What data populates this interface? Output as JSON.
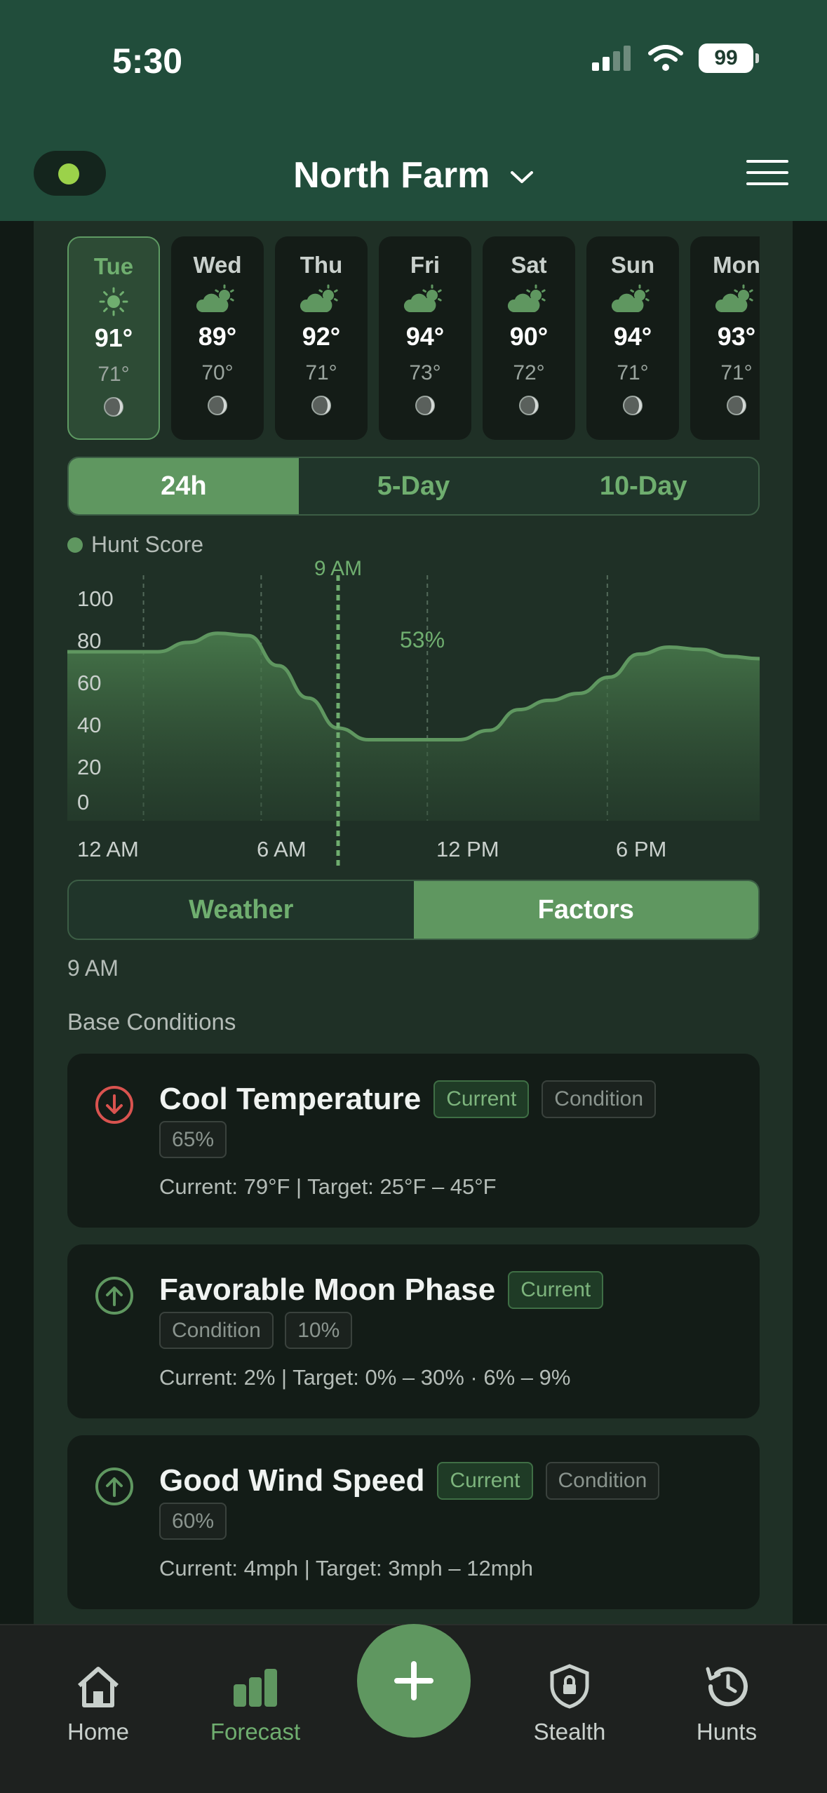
{
  "status": {
    "time": "5:30",
    "battery": "99"
  },
  "header": {
    "location": "North Farm"
  },
  "days": [
    {
      "name": "Tue",
      "hi": "91°",
      "lo": "71°",
      "icon": "sun-icon",
      "selected": true
    },
    {
      "name": "Wed",
      "hi": "89°",
      "lo": "70°",
      "icon": "partly-cloudy-icon"
    },
    {
      "name": "Thu",
      "hi": "92°",
      "lo": "71°",
      "icon": "partly-cloudy-icon"
    },
    {
      "name": "Fri",
      "hi": "94°",
      "lo": "73°",
      "icon": "partly-cloudy-icon"
    },
    {
      "name": "Sat",
      "hi": "90°",
      "lo": "72°",
      "icon": "partly-cloudy-icon"
    },
    {
      "name": "Sun",
      "hi": "94°",
      "lo": "71°",
      "icon": "partly-cloudy-icon"
    },
    {
      "name": "Mon",
      "hi": "93°",
      "lo": "71°",
      "icon": "partly-cloudy-icon"
    }
  ],
  "range_tabs": [
    "24h",
    "5-Day",
    "10-Day"
  ],
  "legend": "Hunt Score",
  "chart_data": {
    "type": "area",
    "series": [
      {
        "name": "Hunt Score",
        "x": [
          0,
          1,
          2,
          3,
          4,
          5,
          6,
          7,
          8,
          9,
          10,
          11,
          12,
          13,
          14,
          15,
          16,
          17,
          18,
          19,
          20,
          21,
          22,
          23
        ],
        "values": [
          73,
          73,
          73,
          73,
          77,
          81,
          80,
          67,
          53,
          40,
          35,
          35,
          35,
          35,
          39,
          48,
          52,
          55,
          62,
          72,
          75,
          74,
          71,
          70
        ]
      }
    ],
    "y_ticks": [
      "100",
      "80",
      "60",
      "40",
      "20",
      "0"
    ],
    "x_ticks": [
      "12 AM",
      "6 AM",
      "12 PM",
      "6 PM"
    ],
    "ylim": [
      0,
      100
    ],
    "marker_label": "9 AM",
    "marker_value": "53%",
    "color": "#5f9760"
  },
  "mode_tabs": [
    "Weather",
    "Factors"
  ],
  "selected_time": "9 AM",
  "section_title": "Base Conditions",
  "factors": [
    {
      "title": "Cool Temperature",
      "trend": "down",
      "badges": [
        "Current",
        "Condition"
      ],
      "percent": "65%",
      "detail": "Current: 79°F | Target: 25°F – 45°F"
    },
    {
      "title": "Favorable Moon Phase",
      "trend": "up",
      "badges": [
        "Current"
      ],
      "extra": "Condition",
      "percent": "10%",
      "detail": "Current: 2% | Target: 0% – 30% · 6% – 9%"
    },
    {
      "title": "Good Wind Speed",
      "trend": "up",
      "badges": [
        "Current",
        "Condition"
      ],
      "percent": "60%",
      "detail": "Current: 4mph | Target: 3mph – 12mph"
    }
  ],
  "nav": {
    "home": "Home",
    "forecast": "Forecast",
    "stealth": "Stealth",
    "hunts": "Hunts"
  }
}
